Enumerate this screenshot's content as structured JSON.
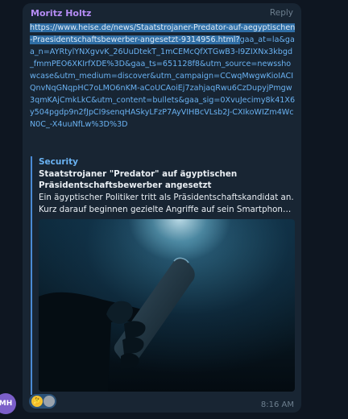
{
  "avatar": {
    "initials": "MH"
  },
  "message": {
    "sender": "Moritz Holtz",
    "reply_label": "Reply",
    "url_selected": "https://www.heise.de/news/Staatstrojaner-Predator-auf-aegyptischen-Praesidentschaftsbewerber-angesetzt-9314956.html?",
    "url_rest": "gaa_at=la&gaa_n=AYRtylYNXgvvK_26UuDtekT_1mCEMcQfXTGwB3-I9ZIXNx3kbgd_fmmPEO6XKIrfXDE%3D&gaa_ts=651128f8&utm_source=newsshowcase&utm_medium=discover&utm_campaign=CCwqMwgwKioIACIQnvNqGNqpHC7oLMO6nKM-aCoUCAoiEj7zahjaqRwu6CzDupyjPmgw3qmKAjCmkLkC&utm_content=bullets&gaa_sig=0XvuJecimy8k41X6y504pgdp9n2fJpCI9senqHASkyLFzP7AyVIHBcVLsb2J-CXIkoWIZm4WcN0C_-X4uuNfLw%3D%3D",
    "time": "8:16 AM"
  },
  "preview": {
    "site": "Security",
    "title": "Staatstrojaner \"Predator\" auf ägyptischen Präsidentschaftsbewerber angesetzt",
    "desc_line1": "Ein ägyptischer Politiker tritt als Präsidentschaftskandidat an.",
    "desc_line2": "Kurz darauf beginnen gezielte Angriffe auf sein Smartphone, u..."
  },
  "reaction": {
    "emoji": "🤔"
  }
}
